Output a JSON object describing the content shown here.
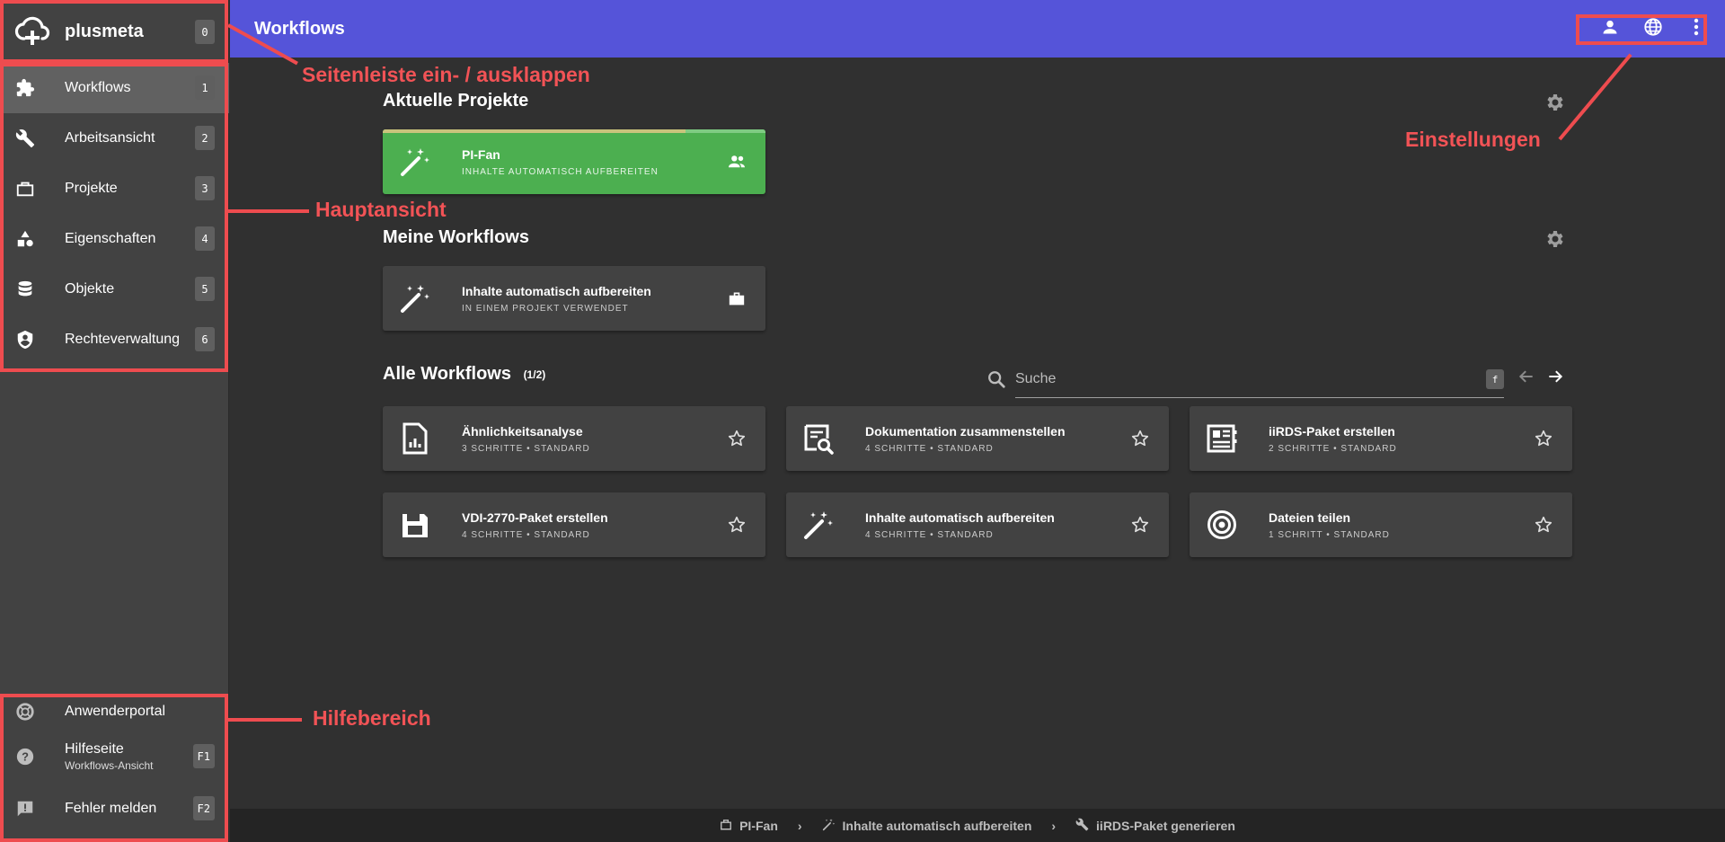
{
  "brand": {
    "name": "plusmeta",
    "shortcut": "0",
    "icon": "cloud-plus-icon"
  },
  "sidebar": {
    "items": [
      {
        "label": "Workflows",
        "shortcut": "1",
        "icon": "puzzle-icon",
        "active": true
      },
      {
        "label": "Arbeitsansicht",
        "shortcut": "2",
        "icon": "wrench-icon"
      },
      {
        "label": "Projekte",
        "shortcut": "3",
        "icon": "briefcase-icon"
      },
      {
        "label": "Eigenschaften",
        "shortcut": "4",
        "icon": "shapes-icon"
      },
      {
        "label": "Objekte",
        "shortcut": "5",
        "icon": "database-icon"
      },
      {
        "label": "Rechteverwaltung",
        "shortcut": "6",
        "icon": "shield-account-icon"
      }
    ]
  },
  "help": {
    "portal": {
      "label": "Anwenderportal",
      "icon": "lifebuoy-icon"
    },
    "helppage": {
      "label": "Hilfeseite",
      "sub": "Workflows-Ansicht",
      "shortcut": "F1",
      "icon": "help-circle-icon"
    },
    "report": {
      "label": "Fehler melden",
      "shortcut": "F2",
      "icon": "report-icon"
    }
  },
  "appbar": {
    "title": "Workflows",
    "actions": [
      "account-icon",
      "globe-icon",
      "more-vert-icon"
    ]
  },
  "annotations": {
    "sidebar_toggle": "Seitenleiste ein- / ausklappen",
    "main_view": "Hauptansicht",
    "settings": "Einstellungen",
    "help_area": "Hilfebereich"
  },
  "current_projects": {
    "title": "Aktuelle Projekte",
    "card": {
      "title": "PI-Fan",
      "subtitle": "INHALTE AUTOMATISCH AUFBEREITEN",
      "progress": 0.79,
      "icon": "magic-wand-icon",
      "action_icon": "people-icon"
    }
  },
  "my_workflows": {
    "title": "Meine Workflows",
    "card": {
      "title": "Inhalte automatisch aufbereiten",
      "subtitle": "IN EINEM PROJEKT VERWENDET",
      "icon": "magic-wand-icon",
      "action_icon": "briefcase-icon"
    }
  },
  "all_workflows": {
    "title": "Alle Workflows",
    "count": "(1/2)",
    "search_placeholder": "Suche",
    "search_shortcut": "f",
    "cards": [
      {
        "title": "Ähnlichkeitsanalyse",
        "subtitle": "3 SCHRITTE • STANDARD",
        "icon": "file-chart-icon"
      },
      {
        "title": "Dokumentation zusammenstellen",
        "subtitle": "4 SCHRITTE • STANDARD",
        "icon": "file-search-icon"
      },
      {
        "title": "iiRDS-Paket erstellen",
        "subtitle": "2 SCHRITTE • STANDARD",
        "icon": "package-icon"
      },
      {
        "title": "VDI-2770-Paket erstellen",
        "subtitle": "4 SCHRITTE • STANDARD",
        "icon": "floppy-icon"
      },
      {
        "title": "Inhalte automatisch aufbereiten",
        "subtitle": "4 SCHRITTE • STANDARD",
        "icon": "magic-wand-icon"
      },
      {
        "title": "Dateien teilen",
        "subtitle": "1 SCHRITT • STANDARD",
        "icon": "target-icon"
      }
    ]
  },
  "footer": {
    "crumbs": [
      {
        "label": "PI-Fan",
        "icon": "briefcase-icon"
      },
      {
        "label": "Inhalte automatisch aufbereiten",
        "icon": "magic-wand-icon"
      },
      {
        "label": "iiRDS-Paket generieren",
        "icon": "wrench-icon"
      }
    ]
  },
  "colors": {
    "accent": "#5554d9",
    "green": "#4caf50",
    "annotation": "#ee4c4f"
  }
}
